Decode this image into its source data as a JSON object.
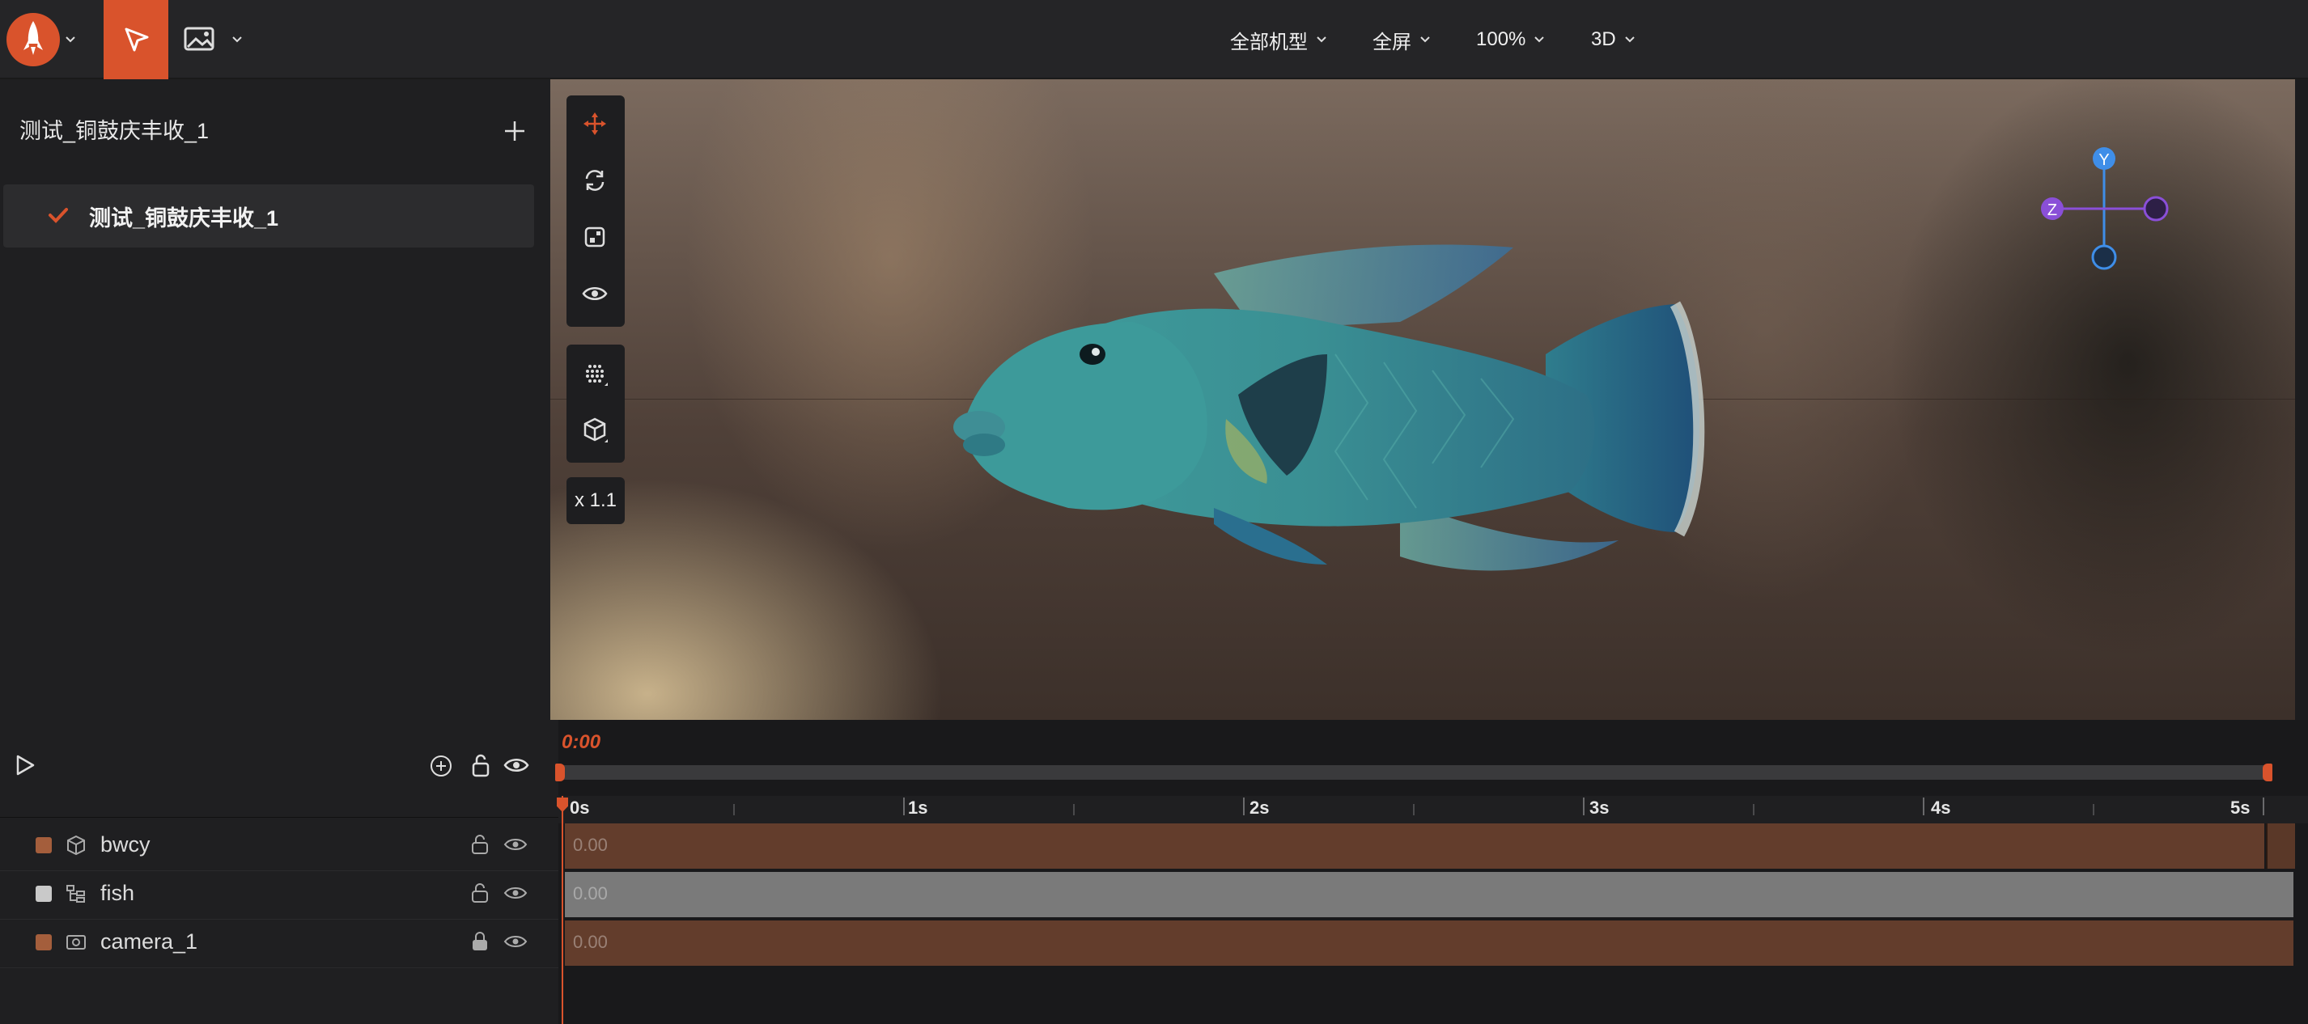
{
  "toolbar": {
    "device_menu": "全部机型",
    "view_menu": "全屏",
    "zoom_menu": "100%",
    "mode_menu": "3D"
  },
  "scene": {
    "title": "测试_铜鼓庆丰收_1",
    "items": [
      {
        "label": "测试_铜鼓庆丰收_1",
        "selected": true
      }
    ]
  },
  "viewport": {
    "scale_badge": "x 1.1",
    "gizmo": {
      "y_label": "Y",
      "z_label": "Z"
    }
  },
  "timeline": {
    "current_time": "0:00",
    "ticks": [
      "0s",
      "1s",
      "2s",
      "3s",
      "4s",
      "5s"
    ],
    "layers": [
      {
        "name": "bwcy",
        "value": "0.00",
        "color": "#a45e3c",
        "track_color": "#633d2c",
        "locked": false
      },
      {
        "name": "fish",
        "value": "0.00",
        "color": "#c9c9c9",
        "track_color": "#7a7a7a",
        "locked": false
      },
      {
        "name": "camera_1",
        "value": "0.00",
        "color": "#a45e3c",
        "track_color": "#633d2c",
        "locked": true
      }
    ]
  },
  "colors": {
    "accent": "#d9532c",
    "gizmo_y": "#3f8ee8",
    "gizmo_z": "#8a4fd8"
  }
}
